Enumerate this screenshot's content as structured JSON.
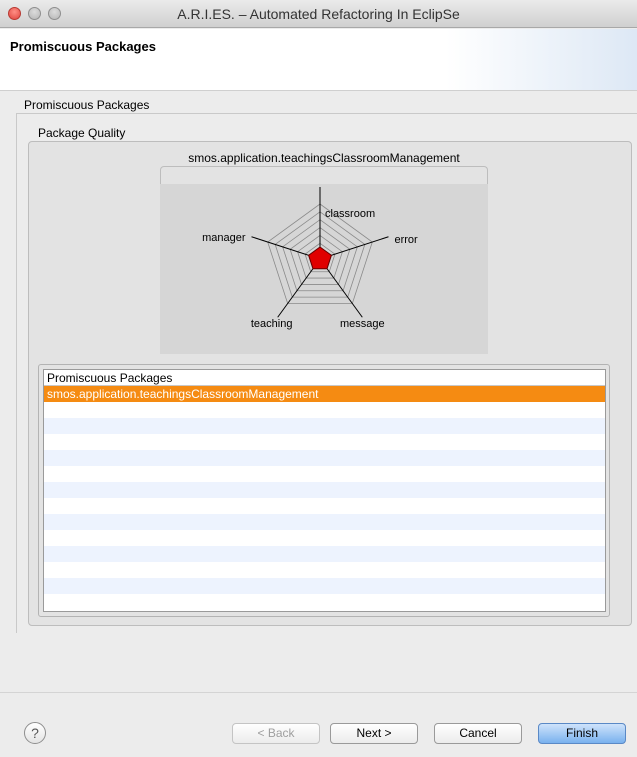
{
  "window": {
    "title": "A.R.I.ES. – Automated Refactoring In EclipSe"
  },
  "header": {
    "heading": "Promiscuous Packages"
  },
  "section": {
    "label": "Promiscuous Packages"
  },
  "group": {
    "label": "Package Quality"
  },
  "chart": {
    "title": "smos.application.teachingsClassroomManagement",
    "axes": [
      "classroom",
      "error",
      "message",
      "teaching",
      "manager"
    ],
    "colors": {
      "fill": "#e00000",
      "grid": "#8a8a8a",
      "axis": "#000000"
    }
  },
  "table": {
    "header": "Promiscuous Packages",
    "rows": [
      "smos.application.teachingsClassroomManagement"
    ],
    "colors": {
      "selected": "#f58b12",
      "alt": "#edf3fe"
    }
  },
  "footer": {
    "help_icon": "question-mark-icon",
    "back": "< Back",
    "next": "Next >",
    "cancel": "Cancel",
    "finish": "Finish"
  }
}
